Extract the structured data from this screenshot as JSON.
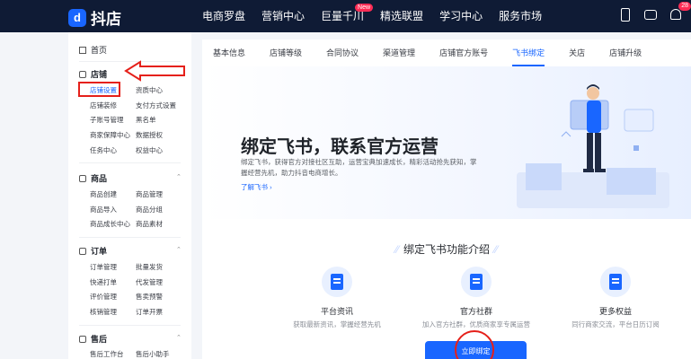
{
  "app": {
    "logo_mark": "d",
    "logo_text": "抖店"
  },
  "nav": {
    "items": [
      {
        "label": "电商罗盘"
      },
      {
        "label": "营销中心"
      },
      {
        "label": "巨量千川",
        "badge": "New"
      },
      {
        "label": "精选联盟"
      },
      {
        "label": "学习中心"
      },
      {
        "label": "服务市场"
      }
    ],
    "notification_badge": "28"
  },
  "sidebar": {
    "home": "首页",
    "groups": [
      {
        "title": "店铺",
        "items": [
          [
            "店铺设置",
            "资质中心"
          ],
          [
            "店铺装修",
            "支付方式设置"
          ],
          [
            "子账号管理",
            "黑名单"
          ],
          [
            "商家保障中心",
            "数据授权"
          ],
          [
            "任务中心",
            "权益中心"
          ]
        ]
      },
      {
        "title": "商品",
        "items": [
          [
            "商品创建",
            "商品管理"
          ],
          [
            "商品导入",
            "商品分组"
          ],
          [
            "商品成长中心",
            "商品素材"
          ]
        ]
      },
      {
        "title": "订单",
        "items": [
          [
            "订单管理",
            "批量发货"
          ],
          [
            "快递打单",
            "代发管理"
          ],
          [
            "评价管理",
            "售卖预警"
          ],
          [
            "核销管理",
            "订单开票"
          ]
        ]
      },
      {
        "title": "售后",
        "items": [
          [
            "售后工作台",
            "售后小助手"
          ]
        ]
      }
    ]
  },
  "tabs": [
    "基本信息",
    "店铺等级",
    "合同协议",
    "渠道管理",
    "店铺官方账号",
    "飞书绑定",
    "关店",
    "店铺升级"
  ],
  "active_tab": "飞书绑定",
  "hero": {
    "title": "绑定飞书，联系官方运营",
    "desc": "绑定飞书，获得官方对接社区互助，运营宝典加速成长，精彩活动抢先获知，掌握经营先机，助力抖音电商增长。",
    "link": "了解飞书 ›"
  },
  "features": {
    "title": "绑定飞书功能介绍",
    "items": [
      {
        "icon": "news-icon",
        "name": "平台资讯",
        "desc": "获取最新资讯，掌握经营先机"
      },
      {
        "icon": "community-icon",
        "name": "官方社群",
        "desc": "加入官方社群，优质商家享专属运营"
      },
      {
        "icon": "benefit-icon",
        "name": "更多权益",
        "desc": "同行商家交流，平台日历订阅"
      }
    ]
  },
  "cta": "立即绑定",
  "colors": {
    "accent": "#1966ff",
    "nav_bg": "#0f1b35",
    "annotation": "#e5201a"
  }
}
